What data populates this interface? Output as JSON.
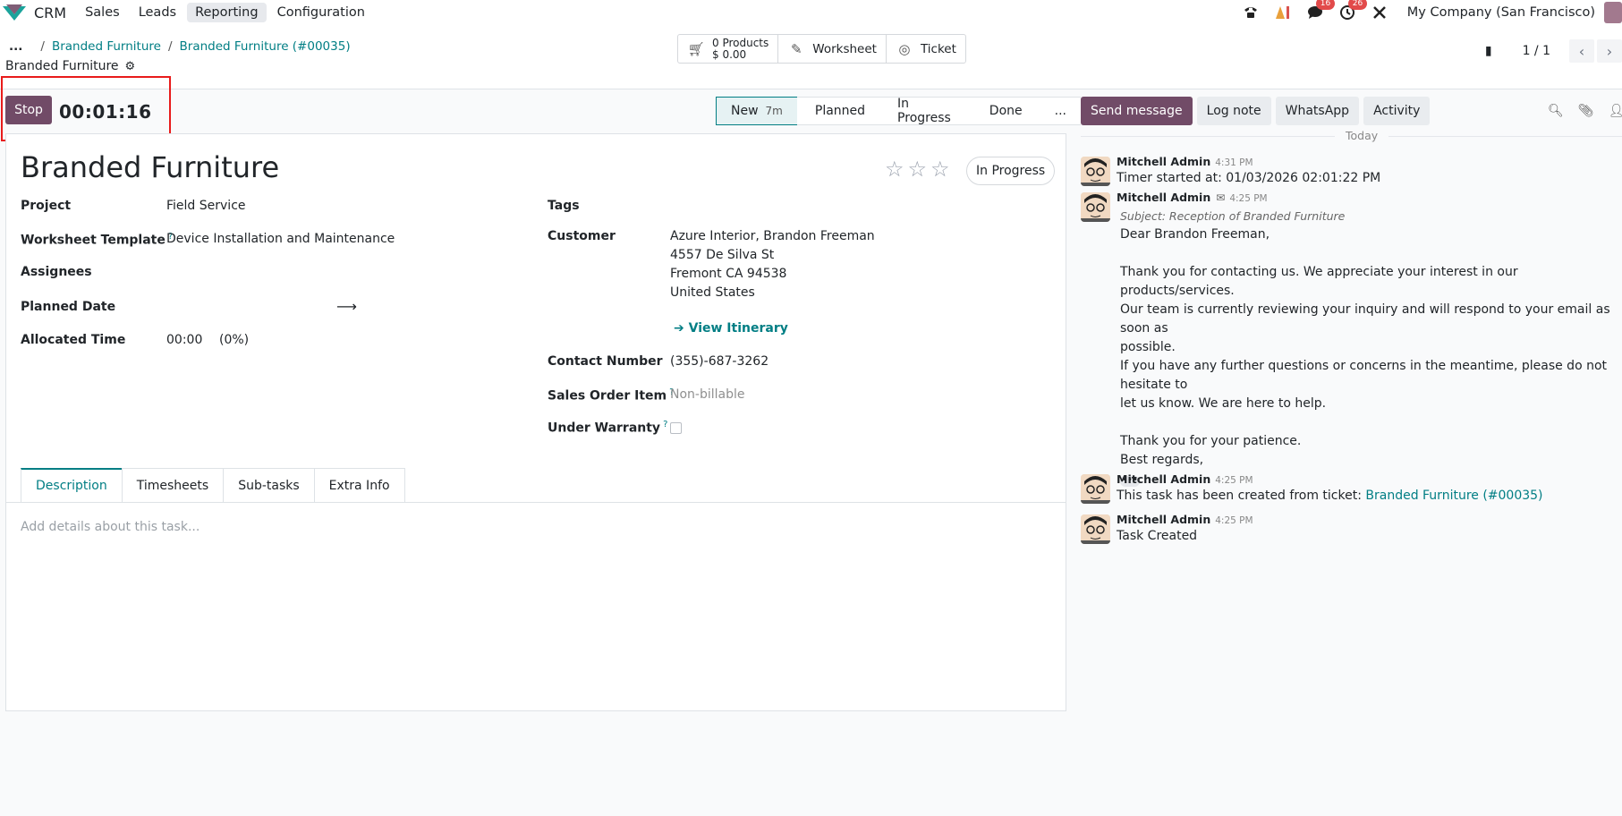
{
  "nav": {
    "app_name": "CRM",
    "menu": [
      "Sales",
      "Leads",
      "Reporting",
      "Configuration"
    ],
    "active_menu": "Reporting",
    "chat_badge": "16",
    "activity_badge": "26",
    "company": "My Company (San Francisco)",
    "icons": [
      "phone-icon",
      "ai-icon",
      "chat-icon",
      "activity-clock-icon",
      "tools-icon"
    ]
  },
  "breadcrumb": {
    "ellipsis": "...",
    "items": [
      "Branded Furniture",
      "Branded Furniture (#00035)"
    ],
    "current": "Branded Furniture"
  },
  "smart_buttons": {
    "products_count": "0 Products",
    "products_amount": "$ 0.00",
    "worksheet": "Worksheet",
    "ticket": "Ticket"
  },
  "pager": {
    "value": "1 / 1"
  },
  "timer": {
    "stop_label": "Stop",
    "elapsed": "00:01:16"
  },
  "stages": [
    {
      "label": "New",
      "minutes": "7m",
      "current": true
    },
    {
      "label": "Planned"
    },
    {
      "label": "In Progress"
    },
    {
      "label": "Done"
    },
    {
      "label": "..."
    }
  ],
  "task": {
    "title": "Branded Furniture",
    "state": "In Progress",
    "priority_stars": 0,
    "fields": {
      "project_label": "Project",
      "project_value": "Field Service",
      "worksheet_label": "Worksheet Template",
      "worksheet_value": "Device Installation and Maintenance",
      "assignees_label": "Assignees",
      "planned_label": "Planned Date",
      "allocated_label": "Allocated Time",
      "allocated_value": "00:00",
      "allocated_pct": "(0%)",
      "tags_label": "Tags",
      "customer_label": "Customer",
      "customer_lines": [
        "Azure Interior, Brandon Freeman",
        "4557 De Silva St",
        "Fremont CA 94538",
        "United States"
      ],
      "itinerary": "View Itinerary",
      "contact_label": "Contact Number",
      "contact_value": "(355)-687-3262",
      "so_item_label": "Sales Order Item",
      "so_item_value": "Non-billable",
      "warranty_label": "Under Warranty"
    },
    "tabs": [
      "Description",
      "Timesheets",
      "Sub-tasks",
      "Extra Info"
    ],
    "active_tab": "Description",
    "description_placeholder": "Add details about this task..."
  },
  "chatter": {
    "send_message": "Send message",
    "log_note": "Log note",
    "whatsapp": "WhatsApp",
    "activity": "Activity",
    "day_label": "Today",
    "messages": [
      {
        "author": "Mitchell Admin",
        "time": "4:31 PM",
        "body": "Timer started at: 01/03/2026 02:01:22 PM"
      },
      {
        "author": "Mitchell Admin",
        "time": "4:25 PM",
        "subject": "Subject: Reception of Branded Furniture",
        "lines": [
          "Dear Brandon Freeman,",
          "",
          "Thank you for contacting us. We appreciate your interest in our products/services.",
          "Our team is currently reviewing your inquiry and will respond to your email as soon as",
          "possible.",
          "If you have any further questions or concerns in the meantime, please do not hesitate to",
          "let us know. We are here to help.",
          "",
          "Thank you for your patience.",
          "Best regards,"
        ]
      },
      {
        "author": "Mitchell Admin",
        "time": "4:25 PM",
        "body": "This task has been created from ticket: ",
        "link": "Branded Furniture (#00035)"
      },
      {
        "author": "Mitchell Admin",
        "time": "4:25 PM",
        "body": "Task Created"
      }
    ]
  },
  "colors": {
    "brand": "#714b67",
    "link": "#017e84",
    "badge": "#e24a4a",
    "highlight": "#e81b1b"
  }
}
